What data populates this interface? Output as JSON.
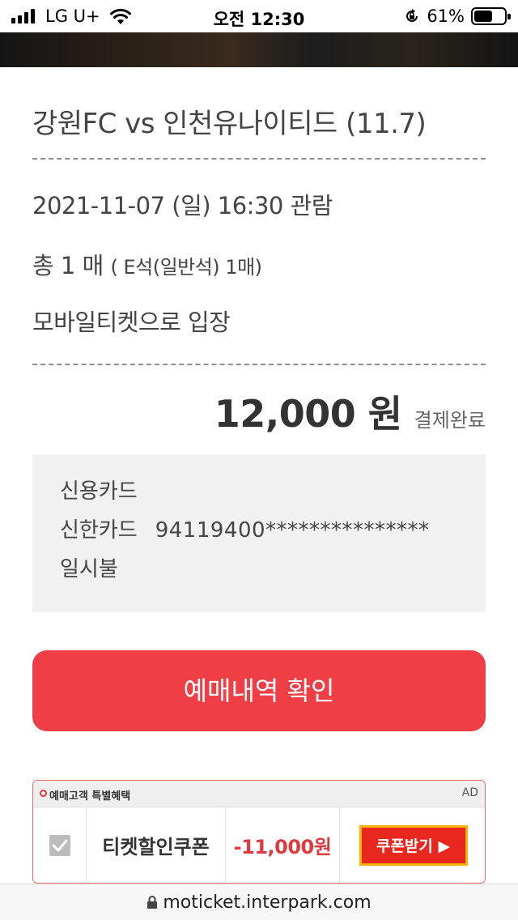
{
  "status_bar": {
    "carrier": "LG U+",
    "time": "오전 12:30",
    "battery_percent": "61%",
    "battery_level": 0.61
  },
  "match": {
    "title": "강원FC vs 인천유나이티드 (11.7)",
    "datetime": "2021-11-07 (일) 16:30 관람",
    "quantity_main": "총 1 매",
    "quantity_detail": "( E석(일반석) 1매)",
    "delivery": "모바일티켓으로 입장"
  },
  "payment": {
    "price": "12,000 원",
    "status": "결제완료",
    "method": "신용카드",
    "card_company": "신한카드",
    "card_number": "94119400***************",
    "installment": "일시불"
  },
  "actions": {
    "confirm_label": "예매내역 확인"
  },
  "ad": {
    "header": "예매고객 특별혜택",
    "label": "AD",
    "coupon_name": "티켓할인쿠폰",
    "coupon_discount": "-11,000원",
    "coupon_button": "쿠폰받기 ▶",
    "checked": true
  },
  "browser": {
    "url": "moticket.interpark.com"
  },
  "colors": {
    "accent": "#ef3e45",
    "discount": "#e0393e",
    "coupon_button": "#e8271f",
    "coupon_button_border": "#f5b400"
  },
  "icons": [
    "signal-icon",
    "wifi-icon",
    "rotation-lock-icon",
    "battery-icon",
    "check-icon",
    "lock-icon"
  ]
}
